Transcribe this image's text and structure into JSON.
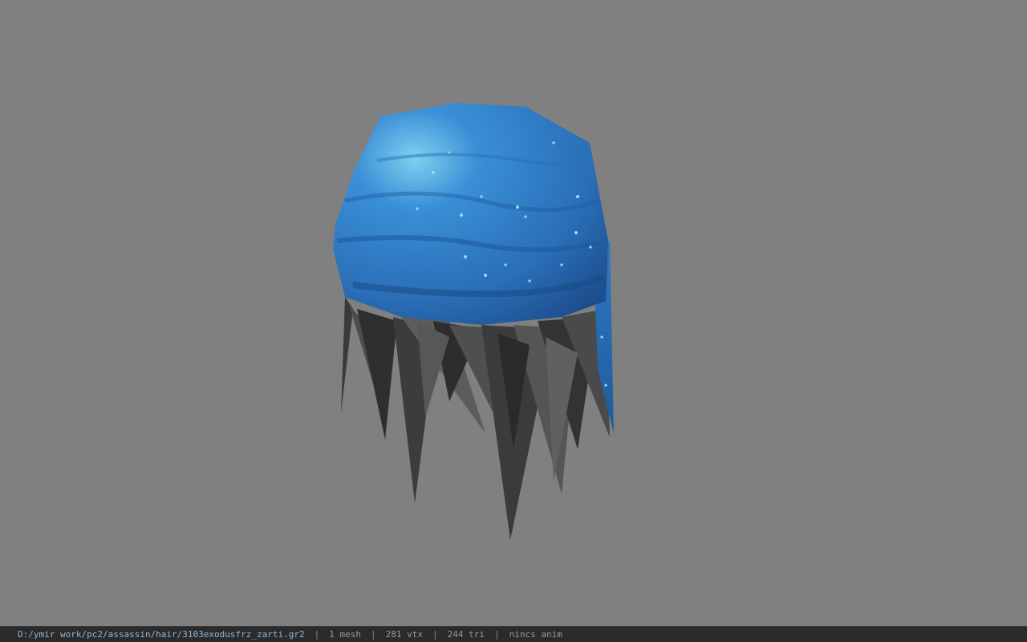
{
  "viewer": {
    "background_color": "#808080",
    "model": {
      "kind": "hair mesh with bandana",
      "bandana_color": "#2f7fc6",
      "hair_color": "#4a4a4a"
    }
  },
  "status_bar": {
    "file_path": "D:/ymir work/pc2/assassin/hair/3103exodusfrz_zarti.gr2",
    "separator": "|",
    "mesh_count": "1 mesh",
    "vertex_count": "281 vtx",
    "triangle_count": "244 tri",
    "anim_state": "nincs anim",
    "path_color": "#8fb7d8",
    "text_color": "#9a9a9a"
  }
}
